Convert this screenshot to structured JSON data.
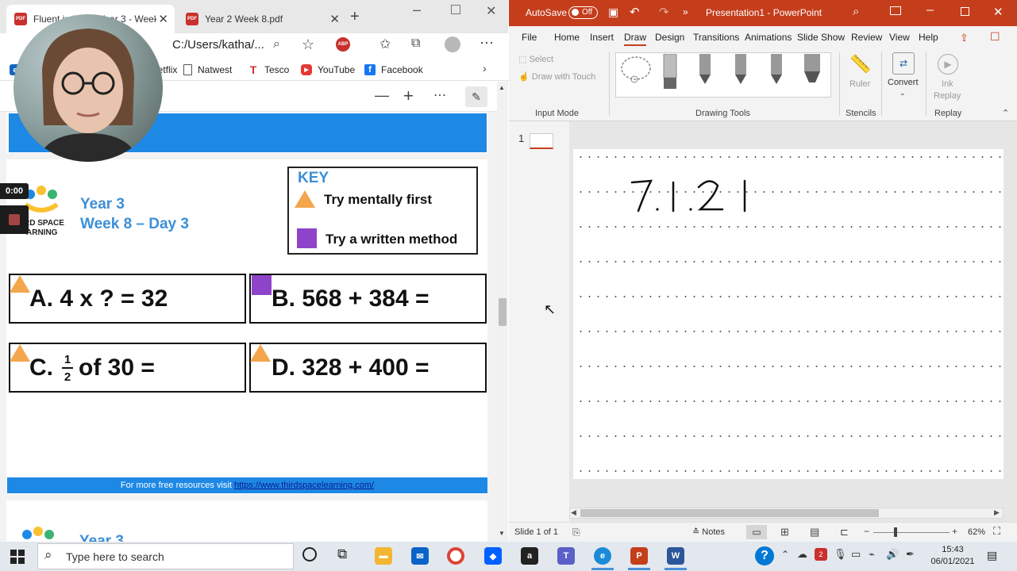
{
  "edge": {
    "tabs": [
      {
        "label": "Fluent in Five - Year 3 - Week 8"
      },
      {
        "label": "Year 2 Week 8.pdf"
      }
    ],
    "address": "C:/Users/katha/...",
    "favorites": [
      {
        "label": "Netflix",
        "icon": "bookmark-icon"
      },
      {
        "label": "Natwest",
        "icon": "page-icon"
      },
      {
        "label": "Tesco",
        "icon": "tesco-icon"
      },
      {
        "label": "YouTube",
        "icon": "youtube-icon"
      },
      {
        "label": "Facebook",
        "icon": "facebook-icon"
      }
    ],
    "abp_label": "ABP"
  },
  "worksheet": {
    "logo_text_line1": "RD SPACE",
    "logo_text_line2": "ARNING",
    "title_line1": "Year 3",
    "title_line2": "Week 8 – Day 3",
    "key": {
      "title": "KEY",
      "mental_label": "Try mentally first",
      "written_label": "Try a written method"
    },
    "questions": {
      "a": "A. 4 x ? = 32",
      "b": "B. 568 + 384 =",
      "c_prefix": "C.",
      "c_num": "1",
      "c_den": "2",
      "c_suffix": "of 30 =",
      "d": "D. 328 + 400 ="
    },
    "footer_text": "For more free resources visit ",
    "footer_link": "https://www.thirdspacelearning.com/",
    "page2_title": "Year 3"
  },
  "recording": {
    "time": "0:00"
  },
  "ppt": {
    "autosave_label": "AutoSave",
    "autosave_state": "Off",
    "title": "Presentation1  -  PowerPoint",
    "tabs": [
      "File",
      "Home",
      "Insert",
      "Draw",
      "Design",
      "Transitions",
      "Animations",
      "Slide Show",
      "Review",
      "View",
      "Help"
    ],
    "active_tab": "Draw",
    "ribbon": {
      "select": "Select",
      "draw_with_touch": "Draw with Touch",
      "input_mode": "Input Mode",
      "drawing_tools": "Drawing Tools",
      "ruler": "Ruler",
      "stencils": "Stencils",
      "convert": "Convert",
      "ink_replay_1": "Ink",
      "ink_replay_2": "Replay",
      "replay": "Replay"
    },
    "slide_number": "1",
    "handwriting": "7.1.2 1",
    "status": {
      "slide": "Slide 1 of 1",
      "notes": "Notes",
      "zoom": "62%"
    }
  },
  "taskbar": {
    "search_placeholder": "Type here to search",
    "time": "15:43",
    "date": "06/01/2021",
    "notification_count": "2"
  },
  "colors": {
    "ppt_red": "#c43e1c",
    "worksheet_blue": "#1e88e5",
    "title_blue": "#3c8fd6",
    "triangle_orange": "#f3a64b",
    "square_purple": "#8e44c8"
  }
}
